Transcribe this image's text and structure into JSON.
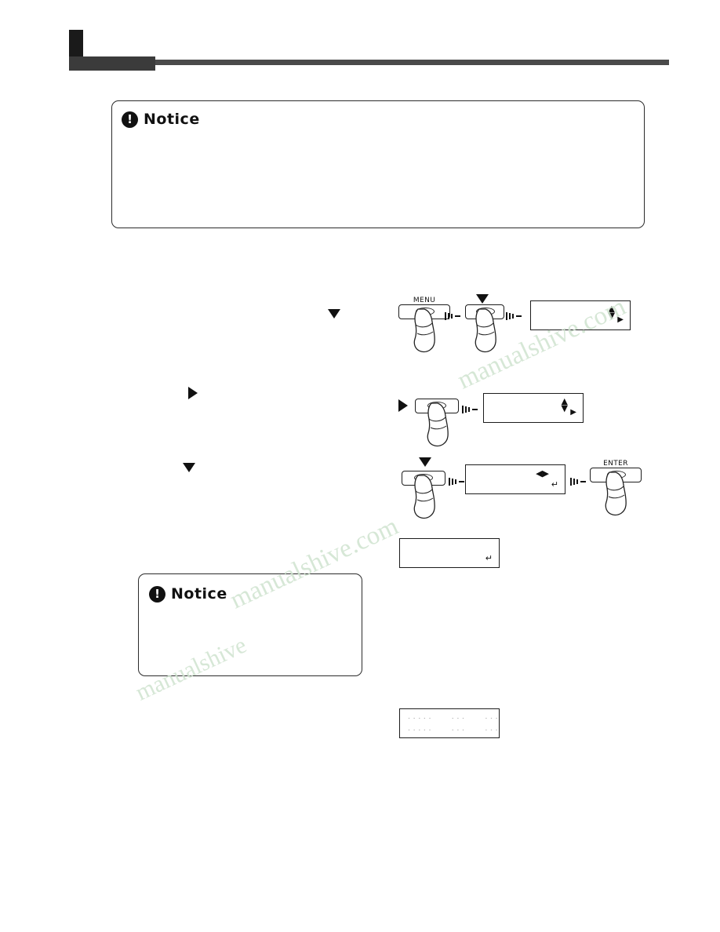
{
  "document": {
    "notices": [
      {
        "id": "notice-top",
        "icon": "exclamation-icon",
        "title": "Notice",
        "body": ""
      },
      {
        "id": "notice-bottom",
        "icon": "exclamation-icon",
        "title": "Notice",
        "body": ""
      }
    ],
    "watermark": {
      "line1": "manualshive.com",
      "line2": "manualshive.com",
      "line3": "manualshive"
    },
    "steps": [
      {
        "marker": "triangle-down",
        "keys": [
          {
            "label": "MENU",
            "name": "menu-key"
          },
          {
            "label": "",
            "name": "down-key"
          }
        ],
        "display": {
          "line1": "",
          "line2": "",
          "indicators": [
            "up-down-arrows",
            "right-arrow"
          ]
        }
      },
      {
        "marker": "triangle-right",
        "keys": [
          {
            "label": "",
            "name": "right-key"
          }
        ],
        "display": {
          "line1": "",
          "line2": "",
          "indicators": [
            "up-down-arrows",
            "right-arrow"
          ]
        }
      },
      {
        "marker": "triangle-down",
        "keys": [
          {
            "label": "",
            "name": "down-key-2"
          },
          {
            "label": "ENTER",
            "name": "enter-key"
          }
        ],
        "display": {
          "line1": "",
          "line2": "",
          "indicators": [
            "left-right-arrows",
            "enter-symbol"
          ]
        }
      },
      {
        "marker": "",
        "keys": [],
        "display": {
          "line1": "",
          "line2": "",
          "indicators": [
            "enter-symbol"
          ]
        }
      }
    ],
    "report": {
      "rows": [
        {
          "cells": [
            "- - - - -",
            "- - -",
            "- - -"
          ]
        },
        {
          "cells": [
            "- - - - -",
            "- - -",
            "- - -"
          ]
        }
      ]
    }
  }
}
